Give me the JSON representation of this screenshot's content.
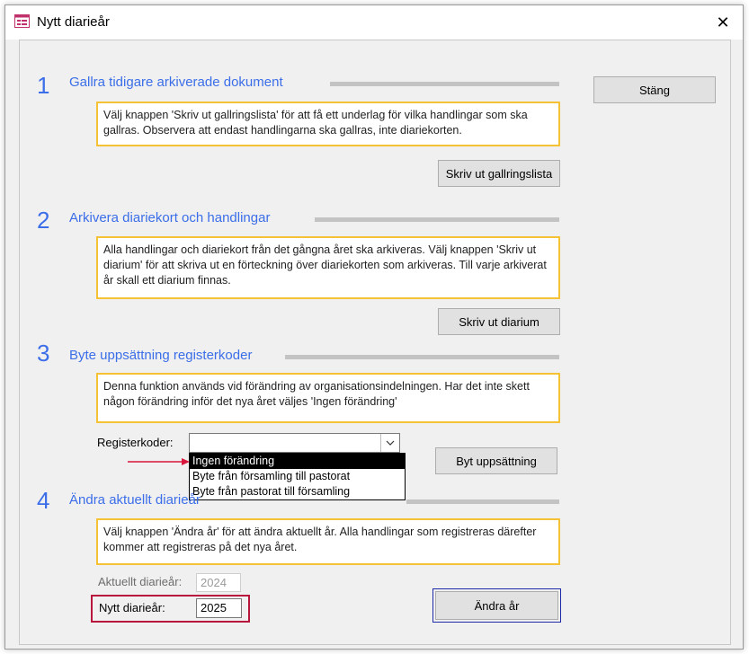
{
  "window": {
    "title": "Nytt diarieår",
    "close_glyph": "✕",
    "icon": "form-window-icon"
  },
  "close_button": {
    "label": "Stäng"
  },
  "sections": [
    {
      "number": "1",
      "title": "Gallra tidigare arkiverade dokument",
      "description": "Välj knappen 'Skriv ut gallringslista' för att få ett underlag för vilka handlingar som ska gallras. Observera att endast handlingarna ska gallras, inte diariekorten.",
      "button": "Skriv ut gallringslista"
    },
    {
      "number": "2",
      "title": "Arkivera diariekort och handlingar",
      "description": "Alla handlingar och diariekort från det gångna året ska arkiveras. Välj knappen 'Skriv ut diarium' för att skriva ut en förteckning över diariekorten som arkiveras. Till varje arkiverat år skall ett diarium finnas.",
      "button": "Skriv ut diarium"
    },
    {
      "number": "3",
      "title": "Byte uppsättning registerkoder",
      "description": "Denna funktion används vid förändring av organisationsindelningen. Har det inte skett någon förändring inför det nya året väljes 'Ingen förändring'",
      "button": "Byt uppsättning"
    },
    {
      "number": "4",
      "title": "Ändra aktuellt diarieår",
      "description": "Välj knappen 'Ändra år' för att ändra aktuellt år. Alla handlingar som registreras därefter kommer att registreras på det nya året.",
      "button": "Ändra år"
    }
  ],
  "registerkoder": {
    "label": "Registerkoder:",
    "value": "",
    "options": [
      "Ingen förändring",
      "Byte från församling till pastorat",
      "Byte från pastorat till församling"
    ],
    "highlighted_index": 0
  },
  "current_year": {
    "label": "Aktuellt diarieår:",
    "value": "2024"
  },
  "new_year": {
    "label": "Nytt diarieår:",
    "value": "2025"
  },
  "colors": {
    "accent_blue": "#3b6ee8",
    "desc_border": "#f5c236",
    "highlight_red": "#b8163d",
    "arrow_red": "#d9163d"
  }
}
